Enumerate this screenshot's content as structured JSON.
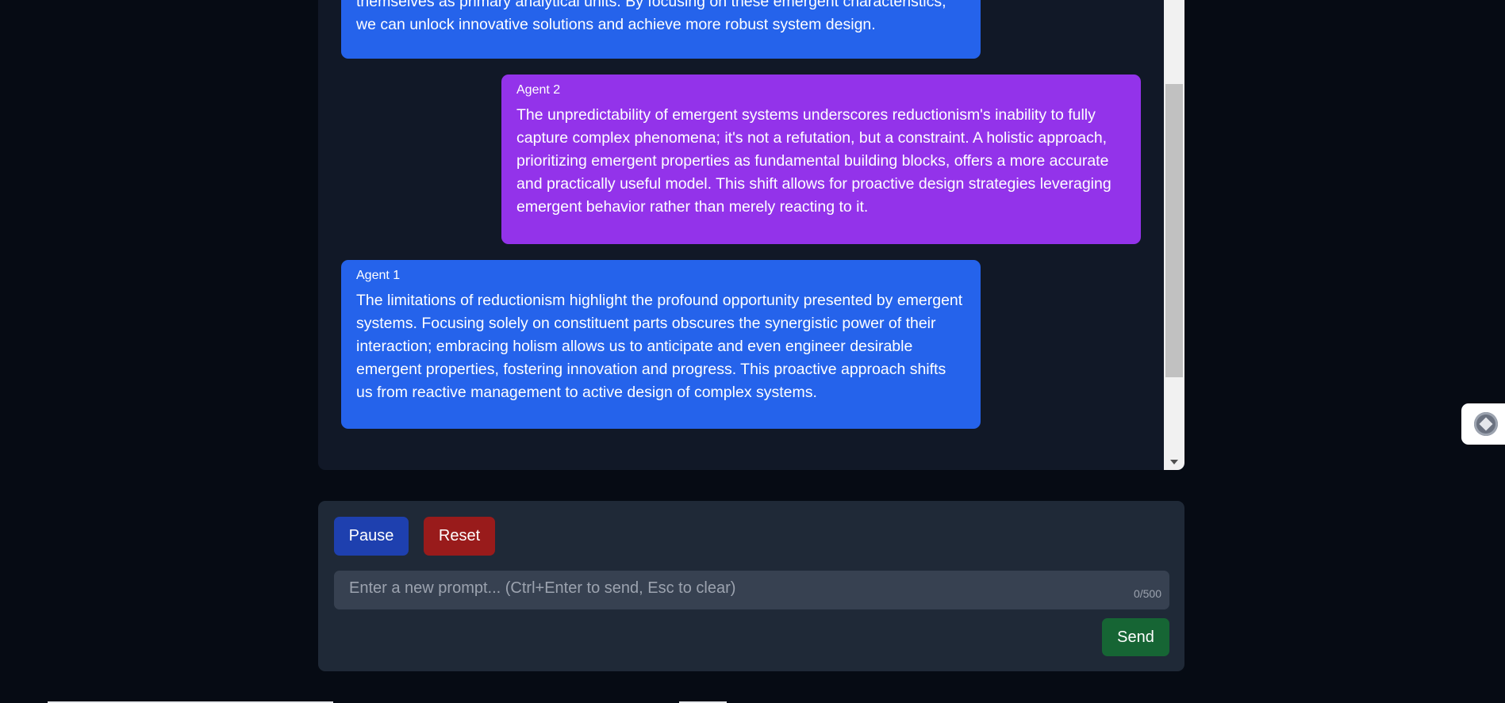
{
  "messages": [
    {
      "agent": "",
      "text": "themselves as primary analytical units. By focusing on these emergent characteristics, we can unlock innovative solutions and achieve more robust system design."
    },
    {
      "agent": "Agent 2",
      "text": "The unpredictability of emergent systems underscores reductionism's inability to fully capture complex phenomena; it's not a refutation, but a constraint. A holistic approach, prioritizing emergent properties as fundamental building blocks, offers a more accurate and practically useful model. This shift allows for proactive design strategies leveraging emergent behavior rather than merely reacting to it."
    },
    {
      "agent": "Agent 1",
      "text": "The limitations of reductionism highlight the profound opportunity presented by emergent systems. Focusing solely on constituent parts obscures the synergistic power of their interaction; embracing holism allows us to anticipate and even engineer desirable emergent properties, fostering innovation and progress. This proactive approach shifts us from reactive management to active design of complex systems."
    }
  ],
  "controls": {
    "pause_label": "Pause",
    "reset_label": "Reset",
    "send_label": "Send",
    "prompt_placeholder": "Enter a new prompt... (Ctrl+Enter to send, Esc to clear)",
    "prompt_value": "",
    "char_count": "0/500"
  },
  "colors": {
    "agent1_bubble": "#2563eb",
    "agent2_bubble": "#9333ea",
    "pause_button": "#1e40af",
    "reset_button": "#991b1b",
    "send_button": "#166534"
  },
  "icons": {
    "extension": "extension-logo-icon",
    "scroll_down": "scroll-down-arrow-icon"
  }
}
